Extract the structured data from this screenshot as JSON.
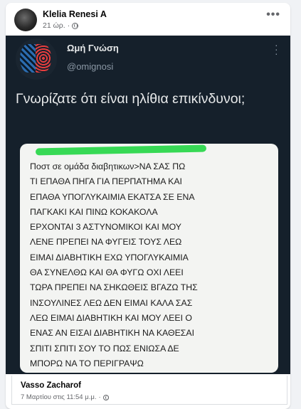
{
  "post": {
    "author": "Klelia Renesi A",
    "time": "21 ώρ.",
    "dot": "·",
    "more_label": "•••"
  },
  "tweet": {
    "name": "Ωμή Γνώση",
    "handle": "@omignosi",
    "text": "Γνωρίζατε ότι είναι ηλίθια επικίνδυνοι;",
    "embedded_message": "Ποστ σε ομάδα διαβητικων>ΝΑ ΣΑΣ ΠΩ\nΤΙ ΕΠΑΘΑ ΠΗΓΑ ΓΙΑ ΠΕΡΠΑΤΗΜΑ ΚΑΙ\nΕΠΑΘΑ  ΥΠΟΓΛΥΚΑΙΜΙΑ  ΕΚΑΤΣΑ ΣΕ ΕΝΑ\nΠΑΓΚΑΚΙ ΚΑΙ ΠΙΝΩ ΚΟΚΑΚΟΛΑ\nΕΡΧΟΝΤΑΙ 3 ΑΣΤΥΝΟΜΙΚΟΙ ΚΑΙ ΜΟΥ\nΛΕΝΕ ΠΡΕΠΕΙ ΝΑ ΦΥΓΕΙΣ ΤΟΥΣ ΛΕΩ\nΕΙΜΑΙ ΔΙΑΒΗΤΙΚΗ ΕΧΩ ΥΠΟΓΛΥΚΑΙΜΙΑ\nΘΑ ΣΥΝΕΛΘΩ ΚΑΙ ΘΑ ΦΥΓΩ ΟΧΙ ΛΕΕΙ\nΤΩΡΑ ΠΡΕΠΕΙ ΝΑ ΣΗΚΩΘΕΙΣ ΒΓΑΖΩ ΤΗΣ\nΙΝΣΟΥΛΙΝΕΣ ΛΕΩ ΔΕΝ ΕΙΜΑΙ ΚΑΛΑ ΣΑΣ\nΛΕΩ ΕΙΜΑΙ ΔΙΑΒΗΤΙΚΗ ΚΑΙ ΜΟΥ ΛΕΕΙ Ο\nΕΝΑΣ ΑΝ ΕΙΣΑΙ ΔΙΑΒΗΤΙΚΗ ΝΑ ΚΑΘΕΣΑΙ\nΣΠΙΤΙ ΣΠΙΤΙ ΣΟΥ ΤΟ ΠΩΣ ΕΝΙΩΣΑ ΔΕ\nΜΠΟΡΩ ΝΑ ΤΟ ΠΕΡΙΓΡΑΨΩ"
  },
  "shared_by": {
    "name": "Vasso Zacharof",
    "time": "7 Μαρτίου στις 11:54 μ.μ.",
    "dot": "·"
  },
  "icons": {
    "privacy": "globe-icon",
    "menu": "more-options-icon"
  },
  "colors": {
    "tweet_background": "#15202b",
    "highlight_marker": "#22d644",
    "facebook_background": "#f0f2f5"
  }
}
